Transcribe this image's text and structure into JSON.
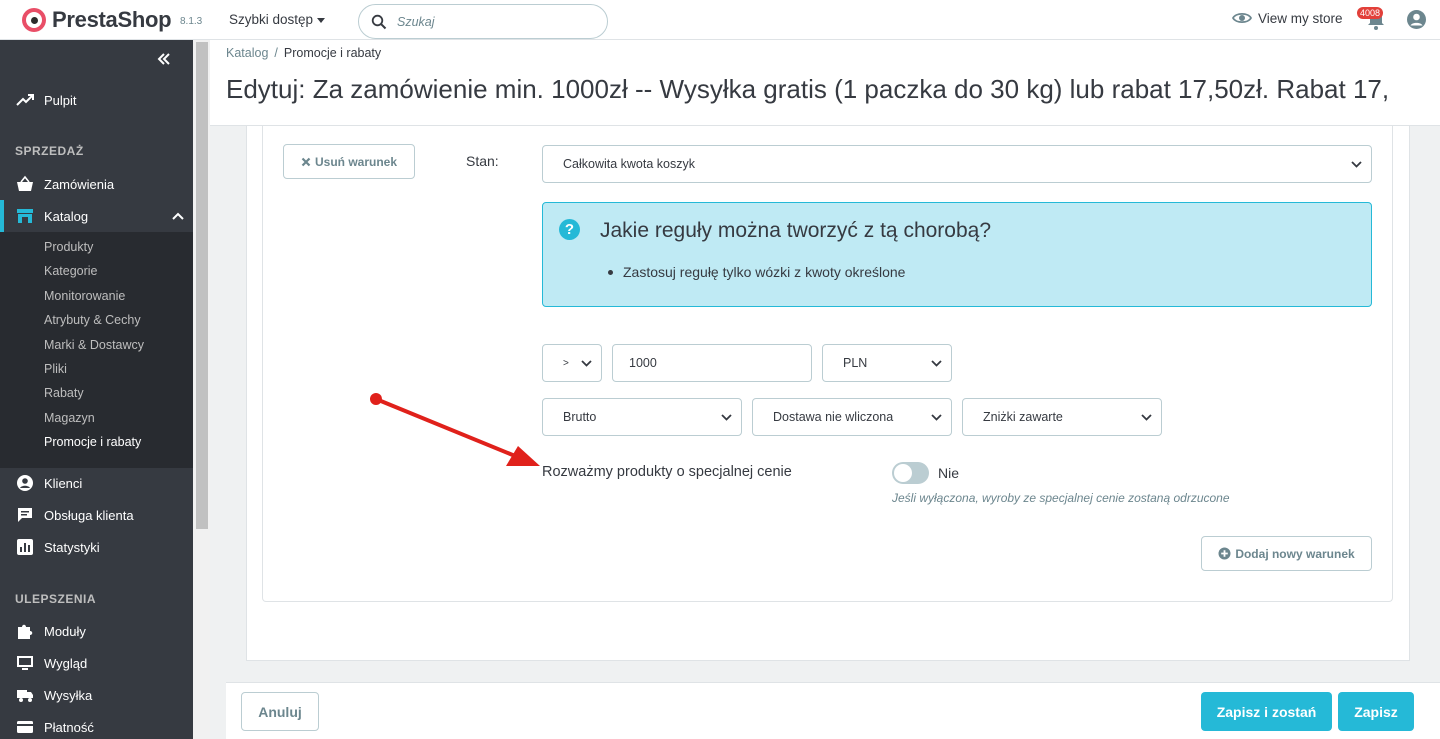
{
  "header": {
    "brand": "PrestaShop",
    "version": "8.1.3",
    "quick_access": "Szybki dostęp",
    "search_placeholder": "Szukaj",
    "view_store": "View my store",
    "notifications_count": "4008"
  },
  "sidebar": {
    "dashboard": "Pulpit",
    "section_sales": "SPRZEDAŻ",
    "orders": "Zamówienia",
    "catalog": "Katalog",
    "catalog_items": [
      "Produkty",
      "Kategorie",
      "Monitorowanie",
      "Atrybuty & Cechy",
      "Marki & Dostawcy",
      "Pliki",
      "Rabaty",
      "Magazyn",
      "Promocje i rabaty"
    ],
    "customers": "Klienci",
    "customer_service": "Obsługa klienta",
    "stats": "Statystyki",
    "section_improve": "ULEPSZENIA",
    "modules": "Moduły",
    "design": "Wygląd",
    "shipping": "Wysyłka",
    "payment": "Płatność"
  },
  "breadcrumb": {
    "parent": "Katalog",
    "separator": "/",
    "current": "Promocje i rabaty"
  },
  "page_title": "Edytuj: Za zamówienie min. 1000zł -- Wysyłka gratis (1 paczka do 30 kg) lub rabat 17,50zł. Rabat 17,",
  "condition": {
    "remove_label": "Usuń warunek",
    "state_label": "Stan:",
    "state_value": "Całkowita kwota koszyk",
    "info_title": "Jakie reguły można tworzyć z tą chorobą?",
    "info_item": "Zastosuj regułę tylko wózki z kwoty określone",
    "operator": ">",
    "amount": "1000",
    "currency": "PLN",
    "tax": "Brutto",
    "shipping": "Dostawa nie wliczona",
    "discounts": "Zniżki zawarte",
    "special_price_label": "Rozważmy produkty o specjalnej cenie",
    "special_price_state": "Nie",
    "special_price_help": "Jeśli wyłączona, wyroby ze specjalnej cenie zostaną odrzucone",
    "add_condition": "Dodaj nowy warunek"
  },
  "footer": {
    "cancel": "Anuluj",
    "save_stay": "Zapisz i zostań",
    "save": "Zapisz"
  },
  "colors": {
    "accent": "#25b9d7",
    "sidebar_bg": "#363a41",
    "annotation_arrow": "#e0211b"
  }
}
